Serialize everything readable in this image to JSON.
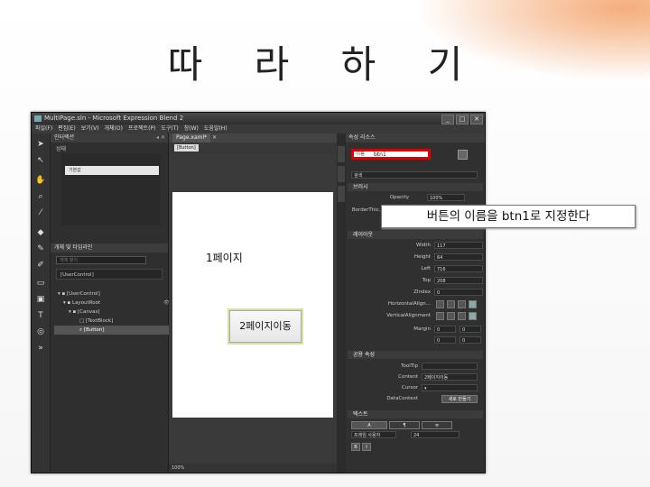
{
  "slide": {
    "title": "따 라 하 기"
  },
  "window": {
    "title": "MultiPage.sln - Microsoft Expression Blend 2",
    "controls": {
      "minimize": "_",
      "maximize": "□",
      "close": "✕"
    }
  },
  "menu": [
    "파일(F)",
    "편집(E)",
    "보기(V)",
    "개체(O)",
    "프로젝트(P)",
    "도구(T)",
    "창(W)",
    "도움말(H)"
  ],
  "left_panel": {
    "states_tab": "인터랙션",
    "states_label": "상태",
    "base_state": "기본값",
    "objects_header": "개체 및 타임라인",
    "search_placeholder": "개체 찾기",
    "usercontrol_label": "[UserControl]",
    "tree": [
      "[UserControl]",
      "LayoutRoot",
      "[Canvas]",
      "[TextBlock]",
      "[Button]"
    ]
  },
  "document": {
    "tab_label": "Page.xaml*",
    "breadcrumb": "[Button]",
    "canvas_label": "1페이지",
    "button_text": "2페이지이동",
    "zoom": "100%"
  },
  "properties": {
    "tabs": "속성   리소스",
    "name_label": "이름",
    "name_value": "btn1",
    "search_placeholder": "검색",
    "brushes_header": "브러시",
    "opacity_label": "Opacity",
    "opacity_value": "100%",
    "border_label": "BorderThic...",
    "border_values": [
      "1",
      "1"
    ],
    "layout_header": "레이아웃",
    "layout": [
      {
        "label": "Width",
        "value": "117"
      },
      {
        "label": "Height",
        "value": "64"
      },
      {
        "label": "Left",
        "value": "716"
      },
      {
        "label": "Top",
        "value": "208"
      },
      {
        "label": "ZIndex",
        "value": "0"
      }
    ],
    "halign_label": "HorizontalAlign...",
    "valign_label": "VerticalAlignment",
    "margin_label": "Margin",
    "margin_values": [
      "0",
      "0",
      "0",
      "0"
    ],
    "common_header": "공용 속성",
    "tooltip_label": "ToolTip",
    "content_label": "Content",
    "content_value": "2페이지이동",
    "cursor_label": "Cursor",
    "datacontext_label": "DataContext",
    "new_button": "새로 만들기",
    "text_header": "텍스트",
    "font_value": "프레임 사용자",
    "font_size": "24",
    "bold": "B",
    "italic": "I"
  },
  "callout": {
    "text": "버튼의 이름을 btn1로 지정한다"
  }
}
